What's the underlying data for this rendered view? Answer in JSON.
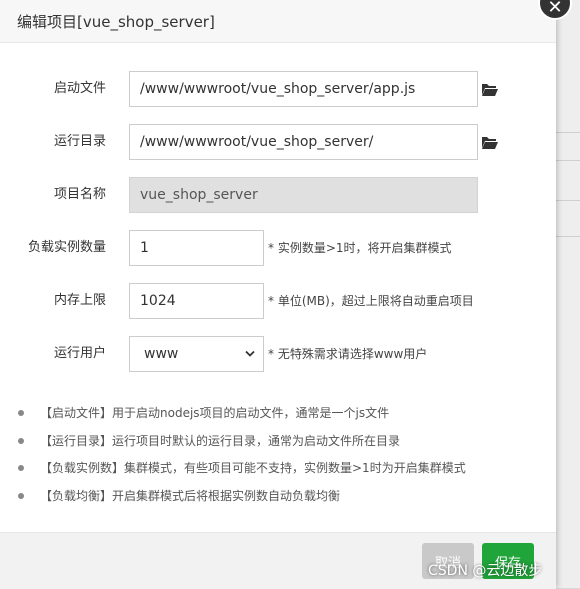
{
  "dialog": {
    "title": "编辑项目[vue_shop_server]"
  },
  "form": {
    "start_file": {
      "label": "启动文件",
      "value": "/www/wwwroot/vue_shop_server/app.js"
    },
    "run_dir": {
      "label": "运行目录",
      "value": "/www/wwwroot/vue_shop_server/"
    },
    "project_name": {
      "label": "项目名称",
      "value": "vue_shop_server"
    },
    "instances": {
      "label": "负载实例数量",
      "value": "1",
      "hint": "* 实例数量>1时，将开启集群模式"
    },
    "memory": {
      "label": "内存上限",
      "value": "1024",
      "hint": "* 单位(MB)，超过上限将自动重启项目"
    },
    "run_user": {
      "label": "运行用户",
      "value": "www",
      "hint": "* 无特殊需求请选择www用户"
    }
  },
  "notes": [
    "【启动文件】用于启动nodejs项目的启动文件，通常是一个js文件",
    "【运行目录】运行项目时默认的运行目录，通常为启动文件所在目录",
    "【负载实例数】集群模式，有些项目可能不支持，实例数量>1时为开启集群模式",
    "【负载均衡】开启集群模式后将根据实例数自动负载均衡"
  ],
  "footer": {
    "cancel_label": "取消",
    "save_label": "保存"
  },
  "watermark": "CSDN @云边散步",
  "colors": {
    "primary": "#20a53a",
    "cancel": "#c9c9c9",
    "disabled_input": "#e0e0e0"
  }
}
